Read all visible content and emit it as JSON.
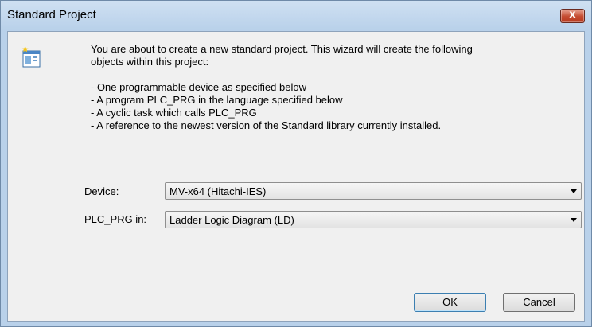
{
  "window": {
    "title": "Standard Project",
    "close_glyph": "x"
  },
  "description": {
    "intro_line1": "You are about to create a new standard project. This wizard will create the following",
    "intro_line2": "objects within this project:",
    "bullets": [
      "- One programmable device as specified below",
      "- A program PLC_PRG in the language specified below",
      "- A cyclic task which calls PLC_PRG",
      "- A reference to the newest version of the Standard library currently installed."
    ]
  },
  "form": {
    "device_label": "Device:",
    "device_value": "MV-x64 (Hitachi-IES)",
    "plc_prg_label": "PLC_PRG in:",
    "plc_prg_value": "Ladder Logic Diagram (LD)"
  },
  "buttons": {
    "ok": "OK",
    "cancel": "Cancel"
  },
  "icons": {
    "wizard": "new-project-wizard-icon",
    "close": "close-icon",
    "dropdown": "chevron-down-icon"
  },
  "colors": {
    "titlebar": "#b9d1ea",
    "client": "#f0f0f0",
    "close_button": "#c44a2f",
    "default_button_border": "#3c7fb1"
  }
}
